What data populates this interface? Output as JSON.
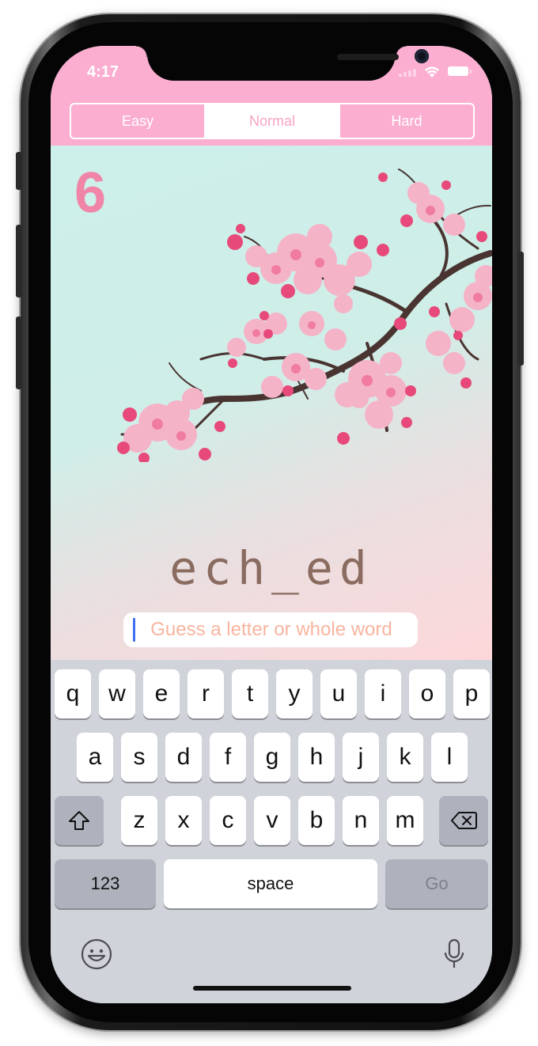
{
  "status_bar": {
    "time": "4:17"
  },
  "difficulty": {
    "options": [
      "Easy",
      "Normal",
      "Hard"
    ],
    "selected": "Normal"
  },
  "game": {
    "lives_remaining": "6",
    "masked_word": "ech_ed",
    "input": {
      "placeholder": "Guess a letter or whole word",
      "value": ""
    }
  },
  "keyboard": {
    "row1": [
      "q",
      "w",
      "e",
      "r",
      "t",
      "y",
      "u",
      "i",
      "o",
      "p"
    ],
    "row2": [
      "a",
      "s",
      "d",
      "f",
      "g",
      "h",
      "j",
      "k",
      "l"
    ],
    "row3": [
      "z",
      "x",
      "c",
      "v",
      "b",
      "n",
      "m"
    ],
    "numbers_key": "123",
    "space_key": "space",
    "return_key": "Go"
  },
  "icons": {
    "shift": "shift-icon",
    "delete": "delete-icon",
    "emoji": "emoji-icon",
    "mic": "microphone-icon",
    "wifi": "wifi-icon",
    "battery": "battery-icon",
    "signal": "cellular-signal-icon"
  },
  "colors": {
    "header_pink": "#fbaed0",
    "lives_pink": "#f085a8",
    "word_brown": "#8a6b5f",
    "placeholder": "#f8b49f",
    "keyboard_bg": "#d1d3da"
  }
}
